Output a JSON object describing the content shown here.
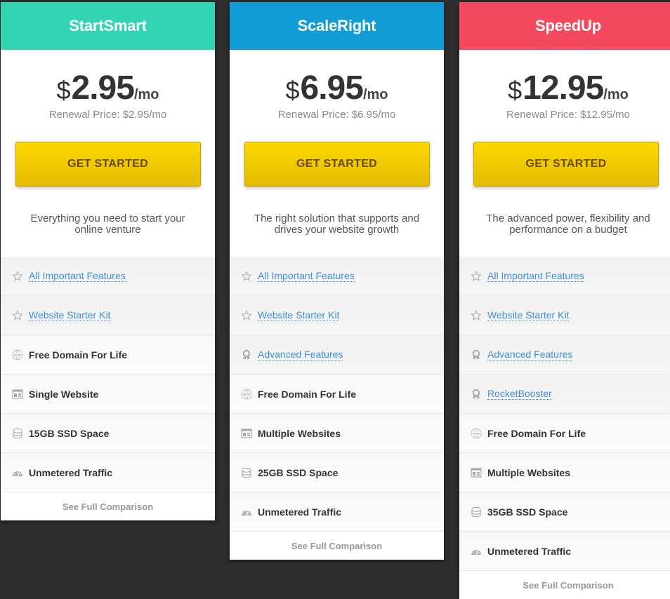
{
  "plans": [
    {
      "name": "StartSmart",
      "header_color": "#33d4b4",
      "price": {
        "currency": "$",
        "amount": "2.95",
        "period": "/mo"
      },
      "renewal": "Renewal Price: $2.95/mo",
      "cta": "GET STARTED",
      "tagline": "Everything you need to start your online venture",
      "features": [
        {
          "icon": "star-icon",
          "label": "All Important Features",
          "link": true
        },
        {
          "icon": "star-icon",
          "label": "Website Starter Kit",
          "link": true
        },
        {
          "icon": "globe-www-icon",
          "label": "Free Domain For Life",
          "link": false
        },
        {
          "icon": "website-layout-icon",
          "label": "Single Website",
          "link": false
        },
        {
          "icon": "database-icon",
          "label": "15GB SSD Space",
          "link": false
        },
        {
          "icon": "speedometer-icon",
          "label": "Unmetered Traffic",
          "link": false
        }
      ],
      "footer": "See Full Comparison"
    },
    {
      "name": "ScaleRight",
      "header_color": "#119cd6",
      "price": {
        "currency": "$",
        "amount": "6.95",
        "period": "/mo"
      },
      "renewal": "Renewal Price: $6.95/mo",
      "cta": "GET STARTED",
      "tagline": "The right solution that supports and drives your website growth",
      "features": [
        {
          "icon": "star-icon",
          "label": "All Important Features",
          "link": true
        },
        {
          "icon": "star-icon",
          "label": "Website Starter Kit",
          "link": true
        },
        {
          "icon": "award-ribbon-icon",
          "label": "Advanced Features",
          "link": true
        },
        {
          "icon": "globe-www-icon",
          "label": "Free Domain For Life",
          "link": false
        },
        {
          "icon": "website-layout-icon",
          "label": "Multiple Websites",
          "link": false
        },
        {
          "icon": "database-icon",
          "label": "25GB SSD Space",
          "link": false
        },
        {
          "icon": "speedometer-icon",
          "label": "Unmetered Traffic",
          "link": false
        }
      ],
      "footer": "See Full Comparison"
    },
    {
      "name": "SpeedUp",
      "header_color": "#f2495e",
      "price": {
        "currency": "$",
        "amount": "12.95",
        "period": "/mo"
      },
      "renewal": "Renewal Price: $12.95/mo",
      "cta": "GET STARTED",
      "tagline": "The advanced power, flexibility and performance on a budget",
      "features": [
        {
          "icon": "star-icon",
          "label": "All Important Features",
          "link": true
        },
        {
          "icon": "star-icon",
          "label": "Website Starter Kit",
          "link": true
        },
        {
          "icon": "award-ribbon-icon",
          "label": "Advanced Features",
          "link": true
        },
        {
          "icon": "award-ribbon-icon",
          "label": "RocketBooster",
          "link": true
        },
        {
          "icon": "globe-www-icon",
          "label": "Free Domain For Life",
          "link": false
        },
        {
          "icon": "website-layout-icon",
          "label": "Multiple Websites",
          "link": false
        },
        {
          "icon": "database-icon",
          "label": "35GB SSD Space",
          "link": false
        },
        {
          "icon": "speedometer-icon",
          "label": "Unmetered Traffic",
          "link": false
        }
      ],
      "footer": "See Full Comparison"
    }
  ],
  "colors": {
    "background": "#2d2d2d",
    "button_top": "#fbd800",
    "button_bottom": "#e3bc00",
    "link": "#3f8fd6"
  }
}
